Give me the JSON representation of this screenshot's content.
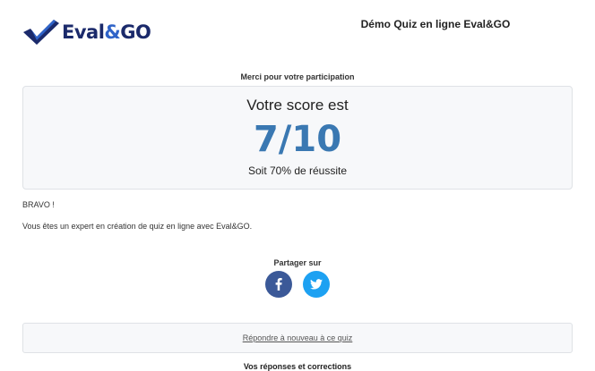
{
  "header": {
    "logo": {
      "text_main": "Eval",
      "text_amp": "&",
      "text_end": "GO",
      "brand_color": "#1b2a6b",
      "accent_color": "#2f63c8"
    },
    "title": "Démo Quiz en ligne Eval&GO"
  },
  "result": {
    "thanks": "Merci pour votre participation",
    "score_title": "Votre score est",
    "score_value": "7/10",
    "score_percent": "Soit 70% de réussite",
    "score_color": "#3a78b2"
  },
  "message": {
    "bravo": "BRAVO !",
    "expert": "Vous êtes un expert en création de quiz en ligne avec Eval&GO."
  },
  "share": {
    "label": "Partager sur",
    "buttons": [
      {
        "name": "facebook",
        "icon": "facebook-icon",
        "color": "#3b5998"
      },
      {
        "name": "twitter",
        "icon": "twitter-icon",
        "color": "#1da1f2"
      }
    ]
  },
  "actions": {
    "retry_label": "Répondre à nouveau à ce quiz"
  },
  "footer": {
    "answers_title": "Vos réponses et corrections"
  }
}
